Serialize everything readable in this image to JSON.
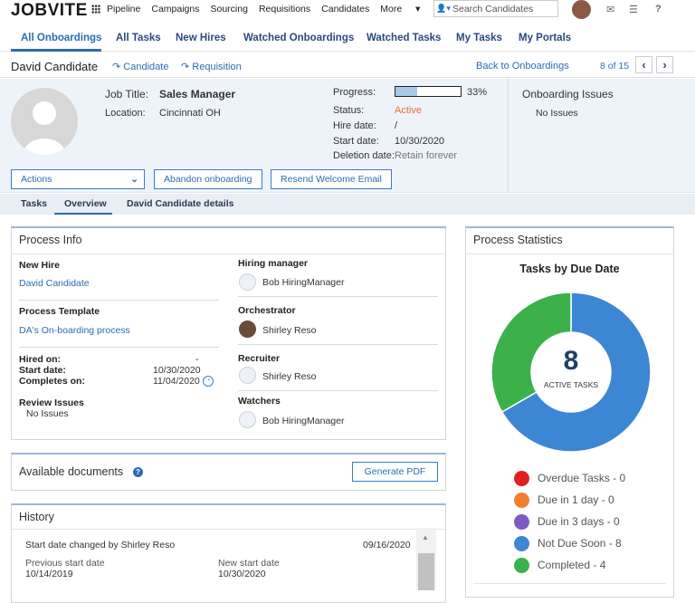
{
  "app": {
    "logo": "JOBVITE",
    "nav": [
      "Pipeline",
      "Campaigns",
      "Sourcing",
      "Requisitions",
      "Candidates",
      "More"
    ],
    "search_placeholder": "Search Candidates"
  },
  "tabs": [
    {
      "label": "All Onboardings",
      "active": true
    },
    {
      "label": "All Tasks"
    },
    {
      "label": "New Hires"
    },
    {
      "label": "Watched Onboardings"
    },
    {
      "label": "Watched Tasks"
    },
    {
      "label": "My Tasks"
    },
    {
      "label": "My Portals"
    }
  ],
  "candidate": {
    "name": "David Candidate",
    "candidate_link": "Candidate",
    "requisition_link": "Requisition",
    "back_link": "Back to Onboardings",
    "pager": "8 of 15"
  },
  "header": {
    "job_title_label": "Job Title:",
    "job_title": "Sales Manager",
    "location_label": "Location:",
    "location": "Cincinnati OH",
    "progress_label": "Progress:",
    "progress_pct": 33,
    "progress_text": "33%",
    "status_label": "Status:",
    "status": "Active",
    "hire_date_label": "Hire date:",
    "hire_date": "/",
    "start_date_label": "Start date:",
    "start_date": "10/30/2020",
    "deletion_label": "Deletion date:",
    "deletion": "Retain forever",
    "issues_title": "Onboarding Issues",
    "issues_value": "No Issues",
    "actions_label": "Actions",
    "abandon_label": "Abandon onboarding",
    "resend_label": "Resend Welcome Email"
  },
  "subtabs": [
    "Tasks",
    "Overview",
    "David Candidate details"
  ],
  "process_info": {
    "title": "Process Info",
    "new_hire_label": "New Hire",
    "new_hire": "David Candidate",
    "template_label": "Process Template",
    "template": "DA's On-boarding process",
    "hired_on_label": "Hired on:",
    "hired_on": "-",
    "start_date_label": "Start date:",
    "start_date": "10/30/2020",
    "completes_label": "Completes on:",
    "completes": "11/04/2020",
    "review_label": "Review Issues",
    "review": "No Issues",
    "hiring_manager_label": "Hiring manager",
    "hiring_manager": "Bob HiringManager",
    "orchestrator_label": "Orchestrator",
    "orchestrator": "Shirley Reso",
    "recruiter_label": "Recruiter",
    "recruiter": "Shirley Reso",
    "watchers_label": "Watchers",
    "watchers": "Bob HiringManager"
  },
  "documents": {
    "title": "Available documents",
    "generate_label": "Generate PDF"
  },
  "history": {
    "title": "History",
    "entry_text": "Start date changed by Shirley Reso",
    "entry_date": "09/16/2020",
    "prev_label": "Previous start date",
    "prev_value": "10/14/2019",
    "new_label": "New start date",
    "new_value": "10/30/2020"
  },
  "stats": {
    "title": "Process Statistics",
    "chart_title": "Tasks by Due Date",
    "center_value": "8",
    "center_label": "ACTIVE TASKS",
    "legend": [
      {
        "label": "Overdue Tasks - 0",
        "color": "#e02020"
      },
      {
        "label": "Due in 1 day - 0",
        "color": "#f08030"
      },
      {
        "label": "Due in 3 days - 0",
        "color": "#7b5cc4"
      },
      {
        "label": "Not Due Soon - 8",
        "color": "#3d86d4"
      },
      {
        "label": "Completed - 4",
        "color": "#3cb14a"
      }
    ]
  },
  "chart_data": {
    "type": "pie",
    "title": "Tasks by Due Date",
    "categories": [
      "Overdue Tasks",
      "Due in 1 day",
      "Due in 3 days",
      "Not Due Soon",
      "Completed"
    ],
    "values": [
      0,
      0,
      0,
      8,
      4
    ],
    "colors": [
      "#e02020",
      "#f08030",
      "#7b5cc4",
      "#3d86d4",
      "#3cb14a"
    ]
  }
}
